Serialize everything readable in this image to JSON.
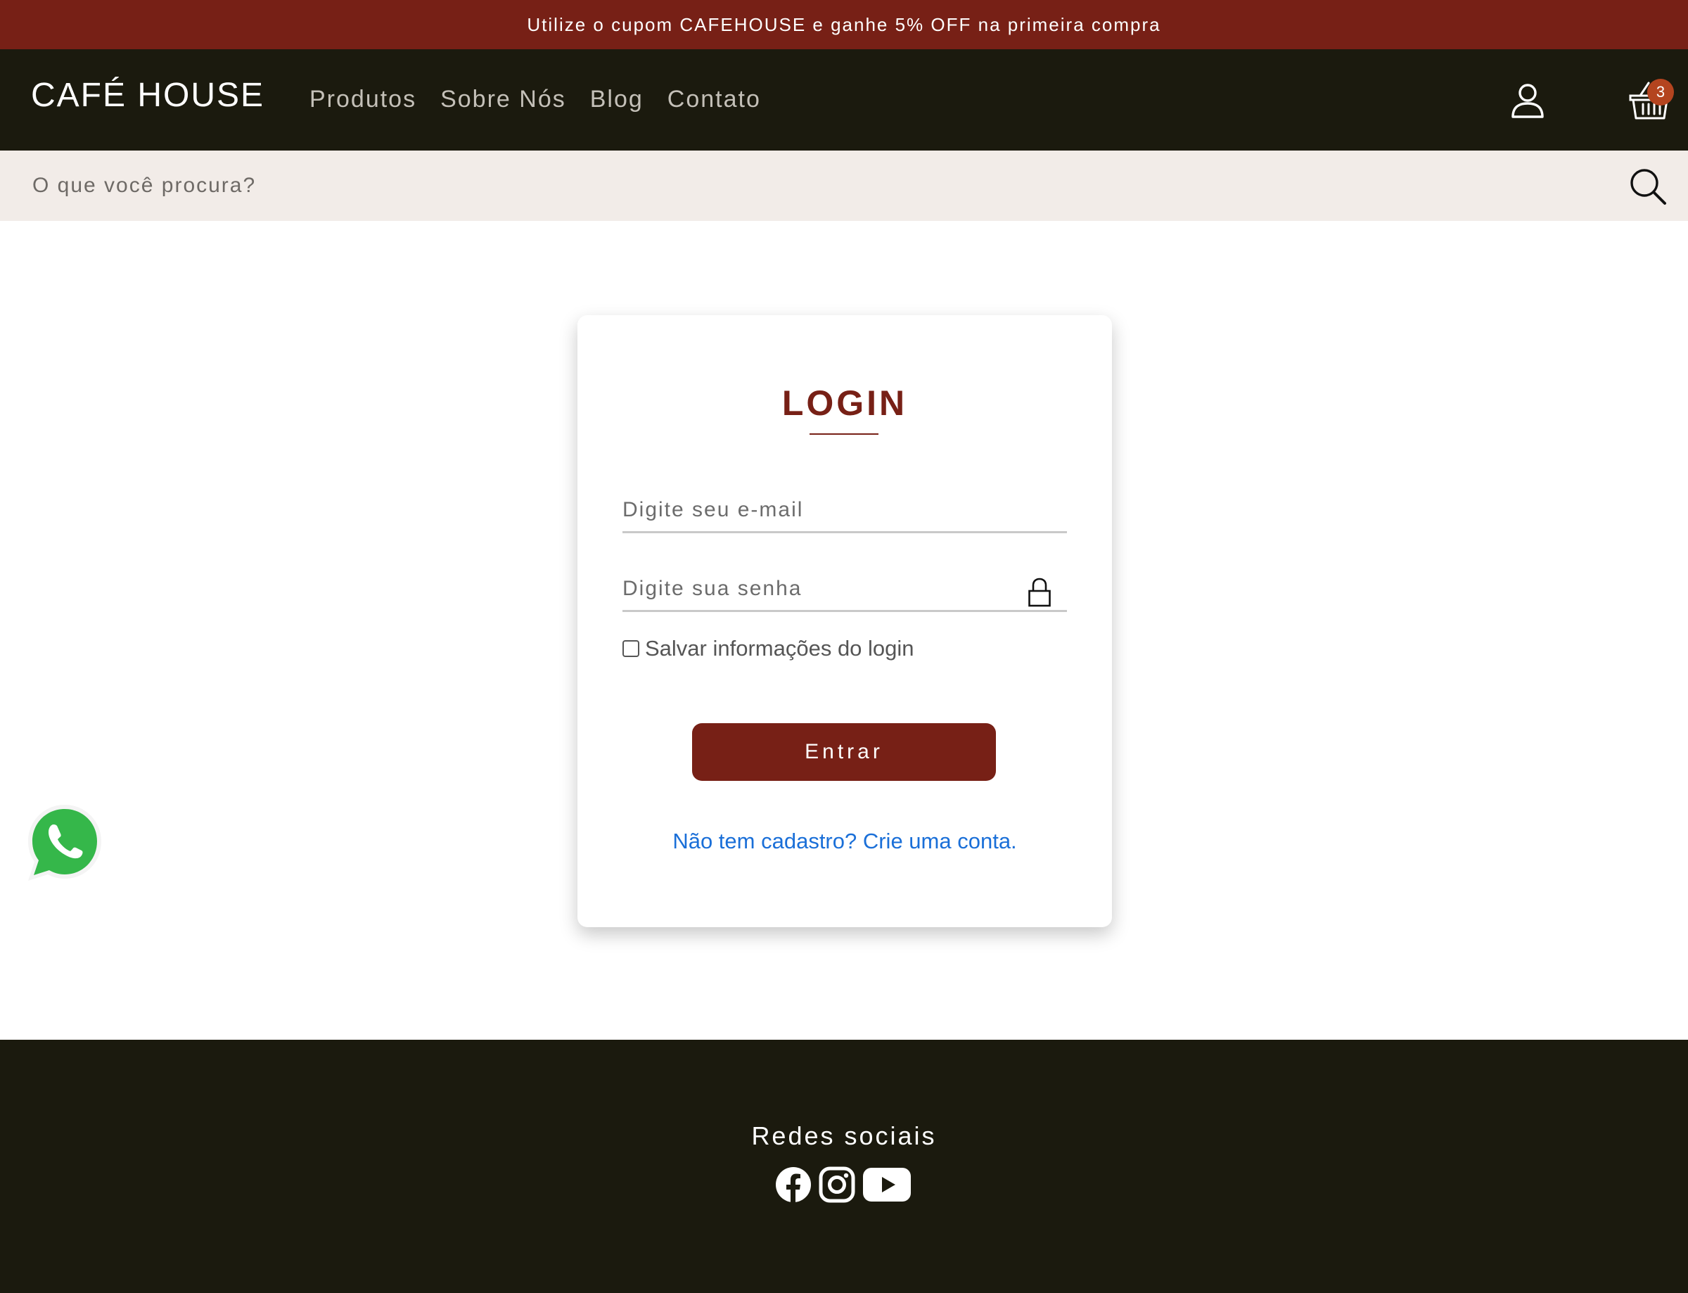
{
  "promo": {
    "text": "Utilize o cupom CAFEHOUSE e ganhe 5% OFF na primeira compra"
  },
  "header": {
    "logo": "CAFÉ HOUSE",
    "nav": [
      {
        "label": "Produtos"
      },
      {
        "label": "Sobre Nós"
      },
      {
        "label": "Blog"
      },
      {
        "label": "Contato"
      }
    ],
    "user_icon": "user-icon",
    "cart_icon": "basket-icon",
    "cart_count": "3"
  },
  "search": {
    "placeholder": "O que você procura?",
    "icon": "search-icon"
  },
  "login": {
    "title": "LOGIN",
    "email_placeholder": "Digite seu e-mail",
    "password_placeholder": "Digite sua senha",
    "password_icon": "lock-icon",
    "remember_label": "Salvar informações do login",
    "remember_checked": false,
    "submit_label": "Entrar",
    "signup_link": "Não tem cadastro? Crie uma conta."
  },
  "whatsapp": {
    "icon": "whatsapp-icon"
  },
  "footer": {
    "social_title": "Redes sociais",
    "social_icons": [
      "facebook-icon",
      "instagram-icon",
      "youtube-icon"
    ]
  },
  "colors": {
    "brand": "#772016",
    "dark": "#1b1a0e",
    "search_bg": "#f2ece8",
    "badge": "#b4441f",
    "link": "#1a6fd8"
  }
}
